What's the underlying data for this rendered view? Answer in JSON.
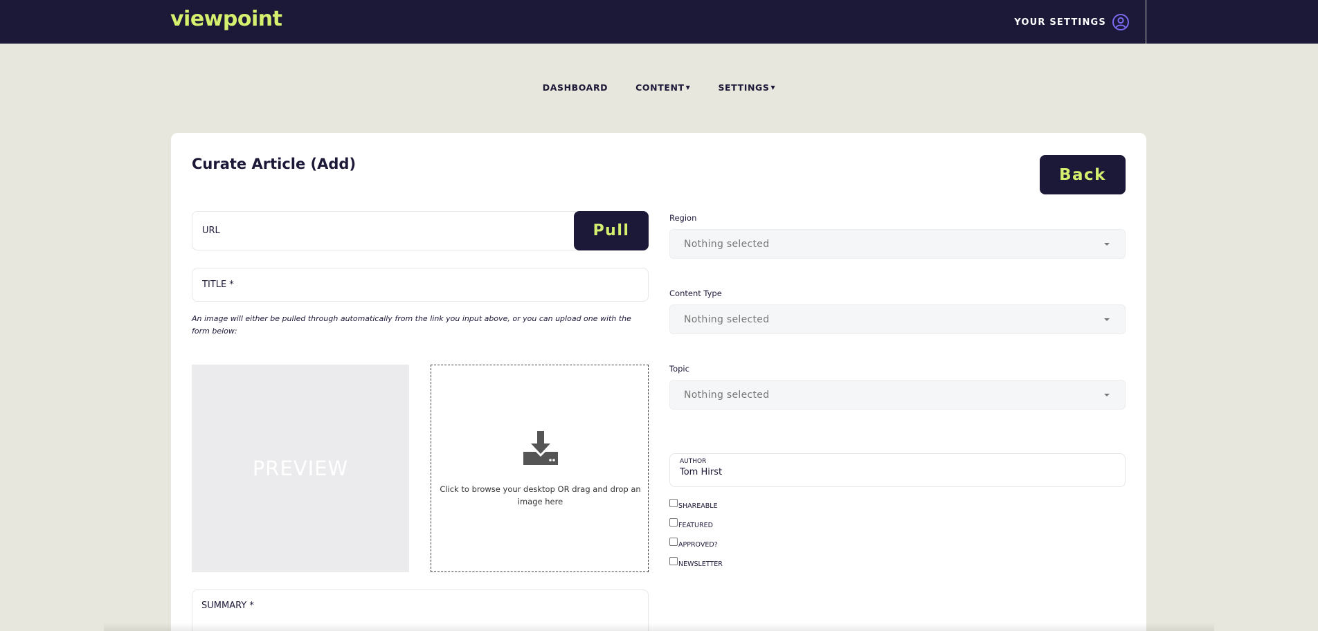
{
  "header": {
    "logo": "viewpoint",
    "settings_label": "YOUR SETTINGS"
  },
  "nav": {
    "items": [
      {
        "label": "DASHBOARD"
      },
      {
        "label": "CONTENT"
      },
      {
        "label": "SETTINGS"
      }
    ]
  },
  "page": {
    "title": "Curate Article (Add)",
    "back_label": "Back"
  },
  "form": {
    "url_placeholder": "URL",
    "pull_label": "Pull",
    "title_placeholder": "TITLE *",
    "image_hint": "An image will either be pulled through automatically from the link you input above, or you can upload one with the form below:",
    "preview_label": "PREVIEW",
    "dropzone_text": "Click to browse your desktop OR drag and drop an image here",
    "summary_label": "SUMMARY *",
    "region": {
      "label": "Region",
      "value": "Nothing selected"
    },
    "content_type": {
      "label": "Content Type",
      "value": "Nothing selected"
    },
    "topic": {
      "label": "Topic",
      "value": "Nothing selected"
    },
    "author": {
      "label": "AUTHOR",
      "value": "Tom Hirst"
    },
    "checkboxes": [
      {
        "label": "SHAREABLE",
        "checked": false
      },
      {
        "label": "FEATURED",
        "checked": false
      },
      {
        "label": "APPROVED?",
        "checked": false
      },
      {
        "label": "NEWSLETTER",
        "checked": false
      }
    ]
  },
  "colors": {
    "navy": "#1c1838",
    "accent": "#d4f06e",
    "background": "#e8e7dd"
  }
}
